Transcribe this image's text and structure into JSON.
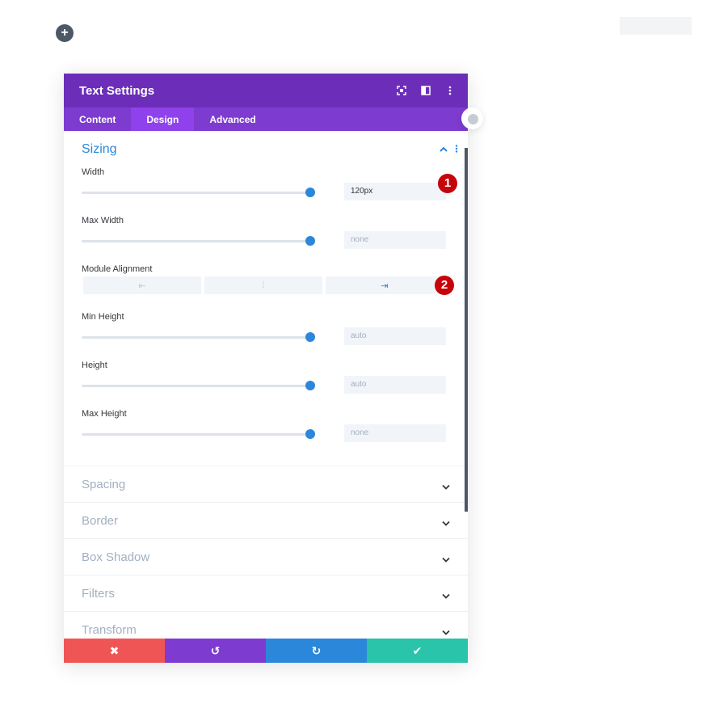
{
  "modal": {
    "title": "Text Settings",
    "tabs": [
      "Content",
      "Design",
      "Advanced"
    ],
    "active_tab": "Design"
  },
  "sizing": {
    "title": "Sizing",
    "width": {
      "label": "Width",
      "value": "120px",
      "level": 1.0
    },
    "max_width": {
      "label": "Max Width",
      "value": "none",
      "level": 1.0
    },
    "alignment": {
      "label": "Module Alignment",
      "options": [
        "left",
        "center",
        "right"
      ],
      "selected": "right"
    },
    "min_height": {
      "label": "Min Height",
      "value": "auto",
      "level": 1.0
    },
    "height": {
      "label": "Height",
      "value": "auto",
      "level": 1.0
    },
    "max_height": {
      "label": "Max Height",
      "value": "none",
      "level": 1.0
    }
  },
  "sections": [
    "Spacing",
    "Border",
    "Box Shadow",
    "Filters",
    "Transform"
  ],
  "badges": [
    "1",
    "2"
  ],
  "footer": {
    "cancel_icon": "close-icon",
    "undo_icon": "undo-icon",
    "redo_icon": "redo-icon",
    "save_icon": "check-icon"
  },
  "colors": {
    "header": "#6c2eb9",
    "tabs": "#7e3bd0",
    "active_tab": "#8f42ec",
    "accent": "#2b87da",
    "cancel": "#ef5555",
    "undo": "#7d3bcf",
    "redo": "#2b87da",
    "save": "#29c4a9",
    "badge": "#c6050b"
  }
}
